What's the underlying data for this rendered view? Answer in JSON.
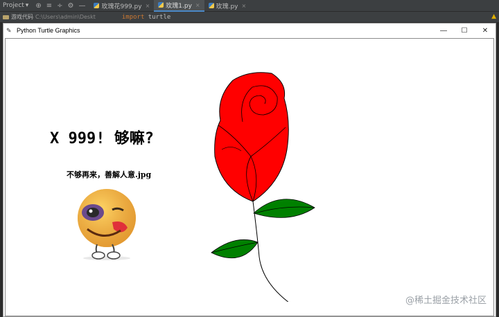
{
  "ide": {
    "project_label": "Project",
    "project_caret": "▾",
    "tool_icons": [
      "⊕",
      "≡",
      "÷",
      "⚙",
      "—"
    ],
    "tabs": [
      {
        "label": "玫瑰花999.py",
        "close": "×",
        "active": false
      },
      {
        "label": "玫瑰1.py",
        "close": "×",
        "active": true
      },
      {
        "label": "玫瑰.py",
        "close": "×",
        "active": false
      }
    ],
    "folder_name": "游戏代码",
    "folder_path": "C:\\Users\\admin\\Deskt",
    "code_keyword": "import",
    "code_module": "turtle",
    "warning_glyph": "▲"
  },
  "window": {
    "title": "Python Turtle Graphics",
    "title_icon": "✎",
    "minimize": "—",
    "maximize": "☐",
    "close": "✕"
  },
  "canvas": {
    "main_text": "X 999! 够嘛?",
    "sub_text": "不够再来，善解人意.jpg"
  },
  "colors": {
    "rose_petal": "#ff0000",
    "leaf": "#008000",
    "outline": "#000000"
  },
  "icons": {
    "emoji": "winking-bruised-face-emoji",
    "rose": "rose-drawing"
  },
  "watermark": "@稀土掘金技术社区"
}
